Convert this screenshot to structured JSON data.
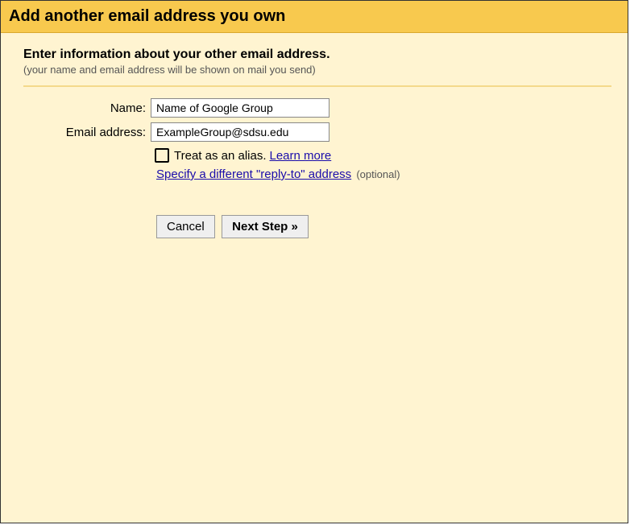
{
  "title": "Add another email address you own",
  "heading": "Enter information about your other email address.",
  "subheading": "(your name and email address will be shown on mail you send)",
  "form": {
    "name_label": "Name:",
    "name_value": "Name of Google Group",
    "email_label": "Email address:",
    "email_value": "ExampleGroup@sdsu.edu"
  },
  "alias": {
    "label": "Treat as an alias.",
    "learn_more": "Learn more"
  },
  "reply_to": {
    "link": "Specify a different \"reply-to\" address",
    "optional": "(optional)"
  },
  "buttons": {
    "cancel": "Cancel",
    "next": "Next Step »"
  }
}
